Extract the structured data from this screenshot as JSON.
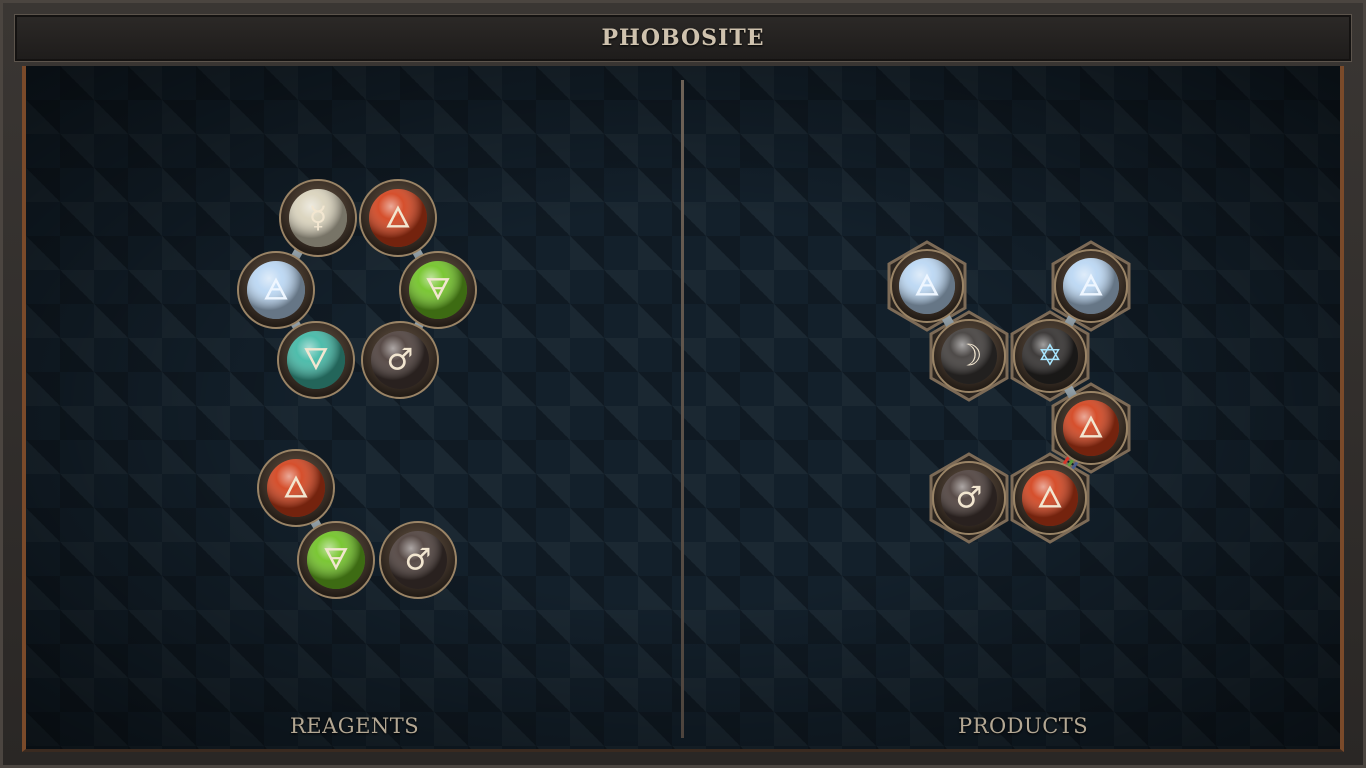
{
  "title": "PHOBOSITE",
  "reagents": {
    "label": "REAGENTS",
    "molecules": [
      {
        "name": "ring",
        "atoms": [
          {
            "id": "a1",
            "element": "quicksilver",
            "symbol": "☿",
            "color": "#d9d2bb"
          },
          {
            "id": "a2",
            "element": "fire",
            "symbol": "🜂",
            "color": "#d2401a"
          },
          {
            "id": "a3",
            "element": "earth",
            "symbol": "🜃",
            "color": "#6fc223"
          },
          {
            "id": "a4",
            "element": "iron",
            "symbol": "♂",
            "color": "#4a3c38"
          },
          {
            "id": "a5",
            "element": "water",
            "symbol": "🜄",
            "color": "#3fb7a4"
          },
          {
            "id": "a6",
            "element": "air",
            "symbol": "🜁",
            "color": "#b9d6f3"
          }
        ]
      },
      {
        "name": "chain",
        "atoms": [
          {
            "id": "b1",
            "element": "fire",
            "symbol": "🜂",
            "color": "#d2401a"
          },
          {
            "id": "b2",
            "element": "earth",
            "symbol": "🜃",
            "color": "#6fc223"
          },
          {
            "id": "b3",
            "element": "iron",
            "symbol": "♂",
            "color": "#4a3c38"
          }
        ]
      }
    ]
  },
  "products": {
    "label": "PRODUCTS",
    "molecules": [
      {
        "name": "product",
        "atoms": [
          {
            "id": "p1",
            "element": "air",
            "symbol": "🜁",
            "color": "#b9d6f3"
          },
          {
            "id": "p2",
            "element": "air",
            "symbol": "🜁",
            "color": "#b9d6f3"
          },
          {
            "id": "p3",
            "element": "silver",
            "symbol": "☽",
            "color": "#3e3a38"
          },
          {
            "id": "p4",
            "element": "vitae-salt",
            "symbol": "✡",
            "color": "#2e2b2a"
          },
          {
            "id": "p5",
            "element": "fire",
            "symbol": "🜂",
            "color": "#d2401a"
          },
          {
            "id": "p6",
            "element": "iron",
            "symbol": "♂",
            "color": "#4a3c38"
          },
          {
            "id": "p7",
            "element": "fire",
            "symbol": "🜂",
            "color": "#d2401a"
          }
        ]
      }
    ]
  }
}
